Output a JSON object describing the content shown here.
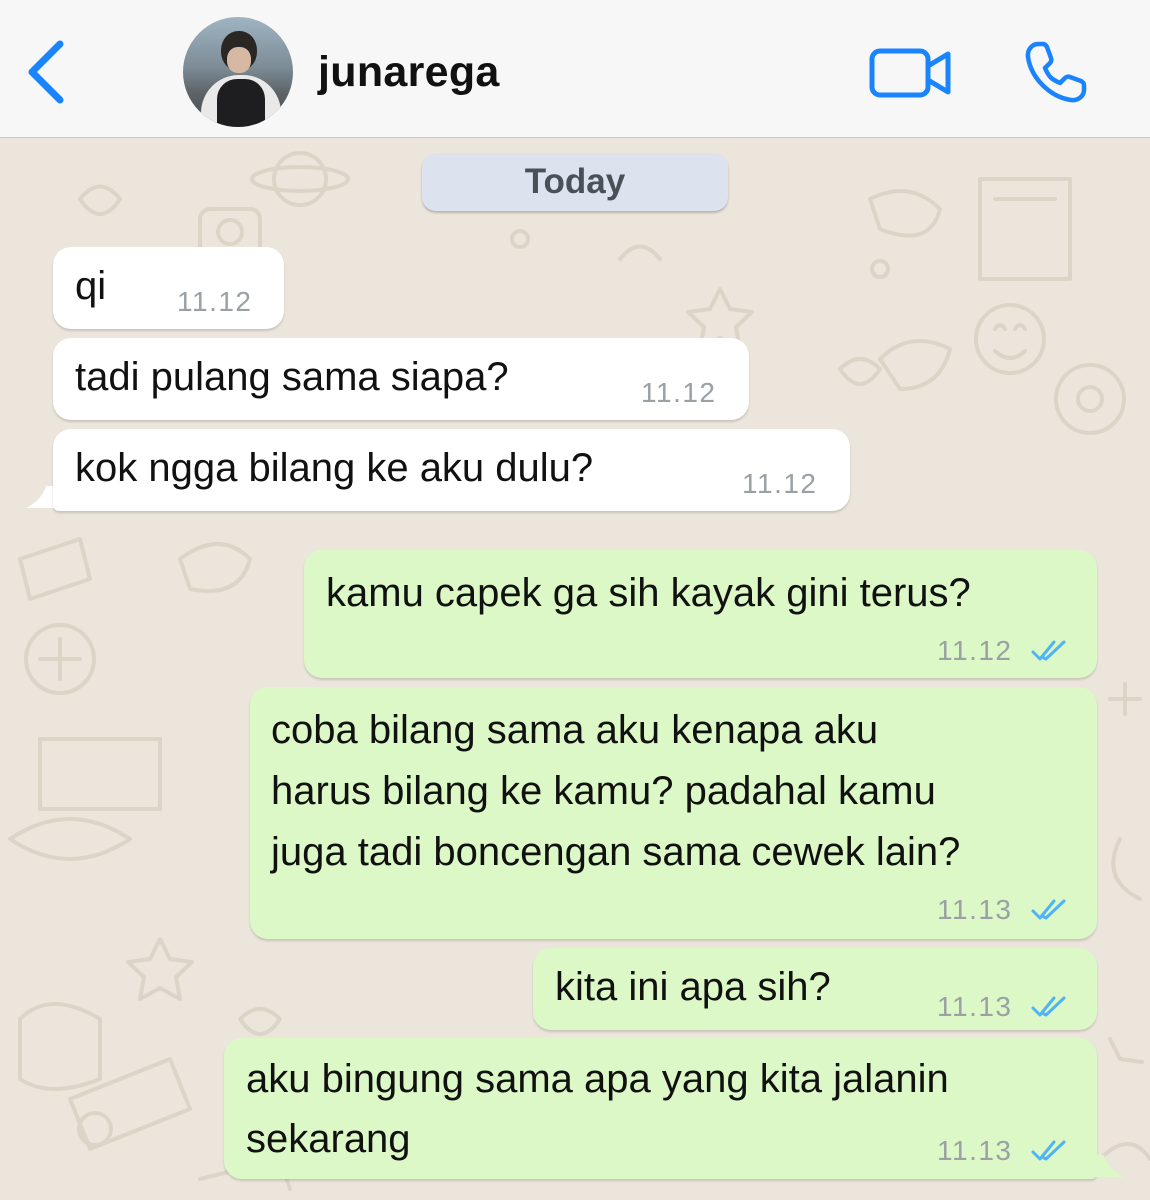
{
  "header": {
    "back_icon": "chevron-left-icon",
    "contact_name": "junarega",
    "video_icon": "video-camera-icon",
    "call_icon": "phone-icon",
    "accent_color": "#1a84ff"
  },
  "chat": {
    "date_label": "Today",
    "messages": [
      {
        "direction": "incoming",
        "lines": [
          "qi"
        ],
        "time": "11.12"
      },
      {
        "direction": "incoming",
        "lines": [
          "tadi pulang sama siapa?"
        ],
        "time": "11.12"
      },
      {
        "direction": "incoming",
        "lines": [
          "kok ngga bilang ke aku dulu?"
        ],
        "time": "11.12"
      },
      {
        "direction": "outgoing",
        "lines": [
          "kamu capek ga sih kayak gini terus?"
        ],
        "time": "11.12",
        "status": "read"
      },
      {
        "direction": "outgoing",
        "lines": [
          "coba bilang sama aku kenapa aku",
          "harus bilang ke kamu? padahal kamu",
          "juga tadi boncengan sama cewek lain?"
        ],
        "time": "11.13",
        "status": "read"
      },
      {
        "direction": "outgoing",
        "lines": [
          "kita ini apa sih?"
        ],
        "time": "11.13",
        "status": "read"
      },
      {
        "direction": "outgoing",
        "lines": [
          "aku bingung sama apa yang kita jalanin",
          "sekarang"
        ],
        "time": "11.13",
        "status": "read"
      }
    ],
    "incoming_color": "#ffffff",
    "outgoing_color": "#dcf8c6",
    "read_tick_color": "#4fb3f6"
  }
}
